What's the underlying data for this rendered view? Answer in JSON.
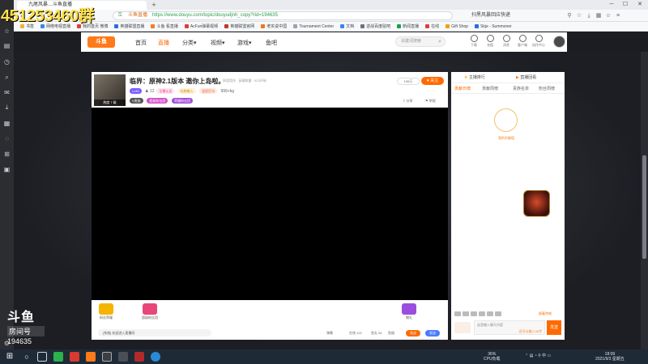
{
  "overlay": {
    "room_id_text": "451253460群",
    "watermark_logo": "斗鱼",
    "watermark_sub": "房间号",
    "watermark_room": "194635"
  },
  "browser": {
    "tab_title": "九尾风暴…斗鱼直播",
    "new_tab_glyph": "+",
    "url_prefix": "斗鱼直播",
    "url": "https://www.douyu.com/topic/douyudjnh_copy?rid=194635",
    "right_text": "扫黑风暴回应快递",
    "bookmarks": [
      {
        "label": "书签",
        "color": "#f0b429"
      },
      {
        "label": "网络电视直播",
        "color": "#3b82f6"
      },
      {
        "label": "我的首页 微博",
        "color": "#e23c3c"
      },
      {
        "label": "英雄联盟直播",
        "color": "#2d6cdf"
      },
      {
        "label": "斗鱼 看直播",
        "color": "#ff7a1a"
      },
      {
        "label": "AcFun弹幕视频",
        "color": "#e23c3c"
      },
      {
        "label": "英雄联盟官网",
        "color": "#c0392b"
      },
      {
        "label": "老实说中国",
        "color": "#f97316"
      },
      {
        "label": "Tournament Center",
        "color": "#9ca3af"
      },
      {
        "label": "文档",
        "color": "#3b82f6"
      },
      {
        "label": "逆战百度贴吧",
        "color": "#6b7280"
      },
      {
        "label": "新闻直播",
        "color": "#16a34a"
      },
      {
        "label": "在线",
        "color": "#e23c3c"
      },
      {
        "label": "Gift Shop",
        "color": "#f59e0b"
      },
      {
        "label": "Skje - Summoner",
        "color": "#2d6cdf"
      }
    ]
  },
  "site": {
    "logo": "斗鱼",
    "nav": [
      "首页",
      "直播",
      "分类▾",
      "视频▾",
      "游戏▾",
      "鱼吧"
    ],
    "active_nav": 1,
    "search_placeholder": "关键词搜索",
    "header_icons": [
      "下载",
      "充值",
      "消息",
      "客户端",
      "创作中心"
    ]
  },
  "room": {
    "anchor_tag": "热度 7 级",
    "title": "临界：原神2.1版本 邀你上岛啦。",
    "category": "网游竞技 · 英雄联盟 · 523开始",
    "level_pill": "Lv30",
    "fans": "12",
    "pill_a": "主播认证",
    "pill_b": "礼物收入",
    "pill_c": "全民打卡",
    "hot": "999+kg",
    "vip": "V贵族",
    "pill_d": "超级粉丝团",
    "pill_e": "荣耀粉丝团",
    "follow_count": "106万",
    "follow_btn": "关注",
    "tool_share": "分享",
    "tool_report": "举报",
    "barrage": "[系统] 欢迎进入直播间",
    "stat_a": "弹幕",
    "stat_b": "在线 122",
    "stat_c": "鱼丸 54",
    "stat_d": "鱼翅",
    "btn_send_a": "发送",
    "btn_send_b": "发送",
    "gift_labels": [
      "粉丝荣耀",
      "超级粉丝团",
      "赠礼"
    ]
  },
  "chat": {
    "top_left": "主播排行",
    "top_right": "直播回看",
    "tabs": [
      "贡献日榜",
      "贡献周榜",
      "贵族名单",
      "粉丝周榜"
    ],
    "active_tab": 0,
    "rank_text": "我的贡献值",
    "tools_right": "屏蔽特效",
    "input_placeholder": "这里输入聊天内容",
    "input_sub": "还可以输入30字",
    "send": "发送"
  },
  "taskbar": {
    "cpu": "36%",
    "cpu_label": "CPU负载",
    "time": "18:09",
    "date": "2021/9/3 星期五"
  }
}
